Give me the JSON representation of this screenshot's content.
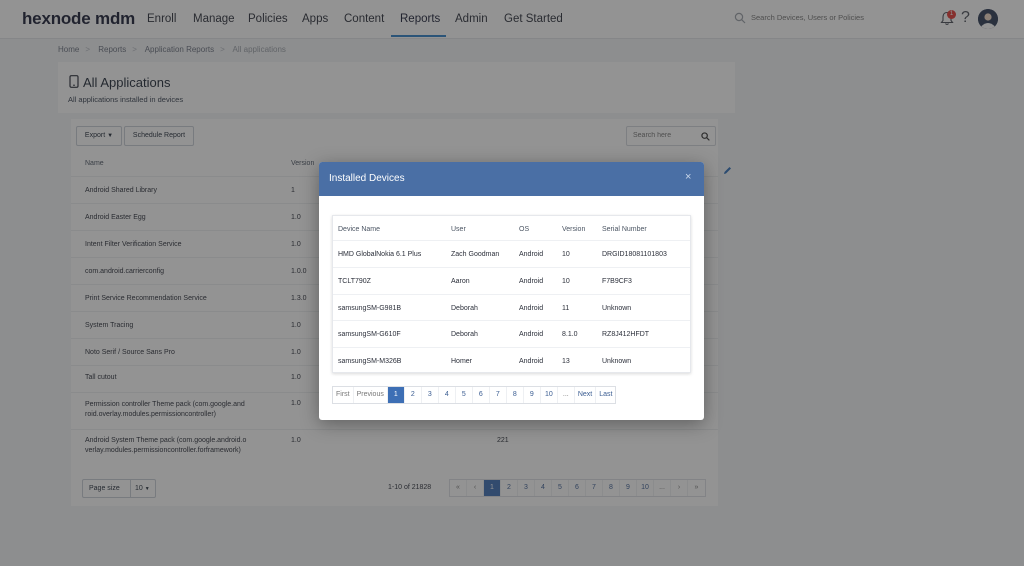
{
  "brand": "hexnode mdm",
  "nav": {
    "items": [
      "Enroll",
      "Manage",
      "Policies",
      "Apps",
      "Content",
      "Reports",
      "Admin",
      "Get Started"
    ],
    "active": "Reports",
    "search_placeholder": "Search Devices, Users or Policies",
    "notification_count": "1",
    "help_label": "?"
  },
  "breadcrumb": [
    "Home",
    "Reports",
    "Application Reports",
    "All applications"
  ],
  "page": {
    "title": "All Applications",
    "subtitle": "All applications installed in devices"
  },
  "toolbar": {
    "export_label": "Export",
    "schedule_label": "Schedule Report",
    "search_placeholder": "Search here"
  },
  "table": {
    "columns": [
      "Name",
      "Version"
    ],
    "rows": [
      {
        "name": "Android Shared Library",
        "version": "1",
        "count": ""
      },
      {
        "name": "Android Easter Egg",
        "version": "1.0",
        "count": ""
      },
      {
        "name": "Intent Filter Verification Service",
        "version": "1.0",
        "count": ""
      },
      {
        "name": "com.android.carrierconfig",
        "version": "1.0.0",
        "count": ""
      },
      {
        "name": "Print Service Recommendation Service",
        "version": "1.3.0",
        "count": ""
      },
      {
        "name": "System Tracing",
        "version": "1.0",
        "count": ""
      },
      {
        "name": "Noto Serif / Source Sans Pro",
        "version": "1.0",
        "count": ""
      },
      {
        "name": "Tall cutout",
        "version": "1.0",
        "count": ""
      },
      {
        "name": "Permission controller Theme pack (com.google.and roid.overlay.modules.permissioncontroller)",
        "version": "1.0",
        "count": ""
      },
      {
        "name": "Android System Theme pack (com.google.android.o verlay.modules.permissioncontroller.forframework)",
        "version": "1.0",
        "count": "221"
      }
    ]
  },
  "footer": {
    "page_size_label": "Page size",
    "page_size_value": "10",
    "range_text": "1-10 of 21828",
    "pages": [
      "«",
      "‹",
      "1",
      "2",
      "3",
      "4",
      "5",
      "6",
      "7",
      "8",
      "9",
      "10",
      "...",
      "›",
      "»"
    ],
    "active_page": "1"
  },
  "modal": {
    "title": "Installed Devices",
    "close_label": "×",
    "columns": [
      "Device Name",
      "User",
      "OS",
      "Version",
      "Serial Number"
    ],
    "rows": [
      {
        "device": "HMD GlobalNokia 6.1 Plus",
        "user": "Zach Goodman",
        "os": "Android",
        "version": "10",
        "serial": "DRGID18081101803"
      },
      {
        "device": "TCLT790Z",
        "user": "Aaron",
        "os": "Android",
        "version": "10",
        "serial": "F7B9CF3"
      },
      {
        "device": "samsungSM-G981B",
        "user": "Deborah",
        "os": "Android",
        "version": "11",
        "serial": "Unknown"
      },
      {
        "device": "samsungSM-G610F",
        "user": "Deborah",
        "os": "Android",
        "version": "8.1.0",
        "serial": "RZ8J412HFDT"
      },
      {
        "device": "samsungSM-M326B",
        "user": "Homer",
        "os": "Android",
        "version": "13",
        "serial": "Unknown"
      }
    ],
    "pages": [
      "First",
      "Previous",
      "1",
      "2",
      "3",
      "4",
      "5",
      "6",
      "7",
      "8",
      "9",
      "10",
      "...",
      "Next",
      "Last"
    ],
    "active_page": "1"
  },
  "colors": {
    "accent": "#3d6fb5",
    "modal_header": "#4a6fa5",
    "nav_underline": "#2f80c8",
    "badge": "#e53935"
  }
}
